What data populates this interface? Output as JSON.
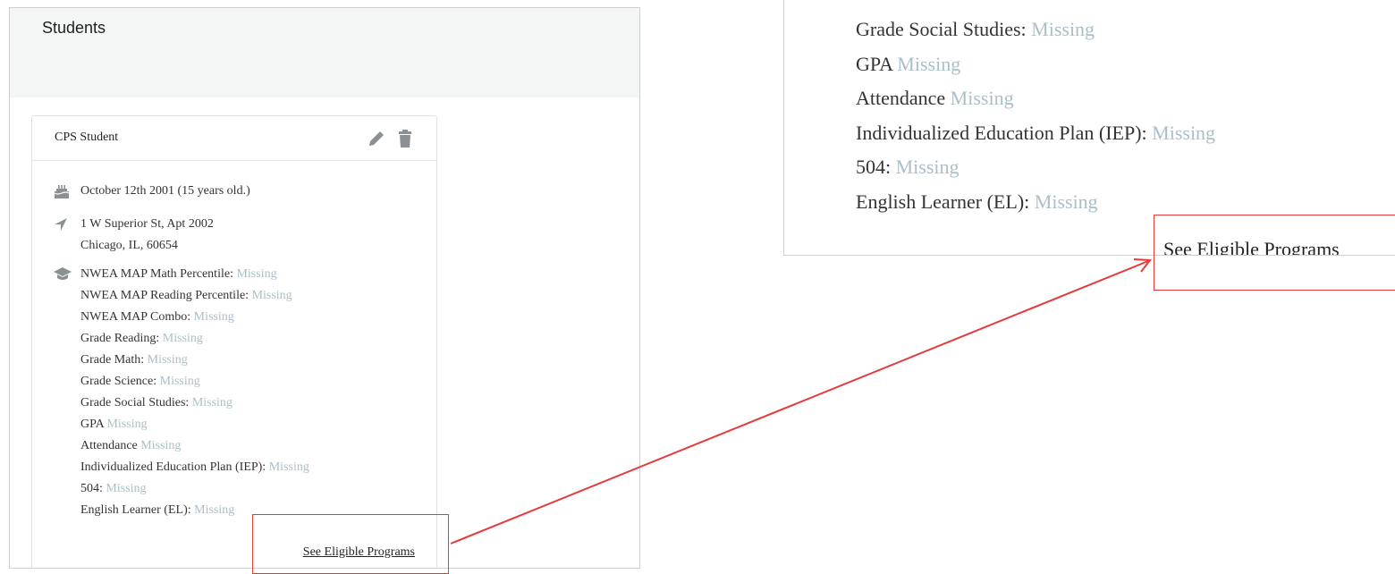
{
  "left": {
    "section_title": "Students",
    "card": {
      "title": "CPS Student",
      "icons": {
        "edit": "pencil-icon",
        "delete": "trash-icon"
      },
      "birthday": {
        "icon": "cake-icon",
        "text": "October 12th 2001 (15 years old.)"
      },
      "address": {
        "icon": "location-arrow-icon",
        "line1": "1 W Superior St, Apt 2002",
        "line2": "Chicago, IL, 60654"
      },
      "academic_icon": "graduation-cap-icon",
      "fields": [
        {
          "label": "NWEA MAP Math Percentile:",
          "value": "Missing"
        },
        {
          "label": "NWEA MAP Reading Percentile:",
          "value": "Missing"
        },
        {
          "label": "NWEA MAP Combo:",
          "value": "Missing"
        },
        {
          "label": "Grade Reading:",
          "value": "Missing"
        },
        {
          "label": "Grade Math:",
          "value": "Missing"
        },
        {
          "label": "Grade Science:",
          "value": "Missing"
        },
        {
          "label": "Grade Social Studies:",
          "value": "Missing"
        },
        {
          "label": "GPA",
          "value": "Missing"
        },
        {
          "label": "Attendance",
          "value": "Missing"
        },
        {
          "label": "Individualized Education Plan (IEP):",
          "value": "Missing"
        },
        {
          "label": "504:",
          "value": "Missing"
        },
        {
          "label": "English Learner (EL):",
          "value": "Missing"
        }
      ],
      "see_link": "See Eligible Programs"
    }
  },
  "right": {
    "fields": [
      {
        "label": "Grade Social Studies:",
        "value": "Missing"
      },
      {
        "label": "GPA",
        "value": "Missing"
      },
      {
        "label": "Attendance",
        "value": "Missing"
      },
      {
        "label": "Individualized Education Plan (IEP):",
        "value": "Missing"
      },
      {
        "label": "504:",
        "value": "Missing"
      },
      {
        "label": "English Learner (EL):",
        "value": "Missing"
      }
    ],
    "see_link": "See Eligible Programs"
  },
  "colors": {
    "missing": "#a9bfc9",
    "callout": "#e63b3b",
    "icon": "#8a9094"
  }
}
